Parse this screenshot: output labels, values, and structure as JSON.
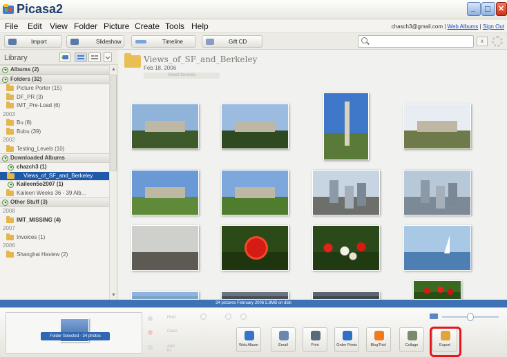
{
  "window": {
    "title": "Picasa2",
    "min_label": "_",
    "max_label": "□",
    "close_label": "✕"
  },
  "menu": [
    "File",
    "Edit",
    "View",
    "Folder",
    "Picture",
    "Create",
    "Tools",
    "Help"
  ],
  "account": {
    "email": "chasch3@gmail.com",
    "sep": "|",
    "web_albums": "Web Albums",
    "sign_out": "Sign Out"
  },
  "toolbar": {
    "import": "Import",
    "slideshow": "Slideshow",
    "timeline": "Timeline",
    "gift_cd": "Gift CD",
    "search_value": "",
    "clear_label": "x"
  },
  "library": {
    "title": "Library",
    "rows": [
      {
        "kind": "section",
        "label": "Albums (2)"
      },
      {
        "kind": "section",
        "label": "Folders (32)"
      },
      {
        "kind": "folder",
        "label": "Picture Porter (15)"
      },
      {
        "kind": "folder",
        "label": "DF_PR (3)"
      },
      {
        "kind": "folder",
        "label": "IMT_Pre-Load (6)"
      },
      {
        "kind": "year",
        "label": "2003"
      },
      {
        "kind": "folder",
        "label": "Bu (8)"
      },
      {
        "kind": "folder",
        "label": "Bubu (39)"
      },
      {
        "kind": "year",
        "label": "2002"
      },
      {
        "kind": "folder",
        "label": "Testing_Levels (10)"
      },
      {
        "kind": "section",
        "label": "Downloaded Albums"
      },
      {
        "kind": "sub",
        "label": "chazch3 (1)"
      },
      {
        "kind": "selected",
        "label": "Views_of_SF_and_Berkeley"
      },
      {
        "kind": "sub",
        "label": "Kaileen5o2007 (1)"
      },
      {
        "kind": "folder",
        "label": "Kaileen Weeks 36 - 39 Alb..."
      },
      {
        "kind": "section",
        "label": "Other Stuff (3)"
      },
      {
        "kind": "year",
        "label": "2008"
      },
      {
        "kind": "folder-bold",
        "label": "IMT_MISSING (4)"
      },
      {
        "kind": "year",
        "label": "2007"
      },
      {
        "kind": "folder",
        "label": "Invoices (1)"
      },
      {
        "kind": "year",
        "label": "2006"
      },
      {
        "kind": "folder",
        "label": "Shanghai Haview (2)"
      }
    ]
  },
  "folder": {
    "title": "Views_of_SF_and_Berkeley",
    "date": "Feb 18, 2006",
    "action": "Select Sources"
  },
  "photos": [
    {
      "desc": "Berkeley Sather Gate",
      "sky": "#8fb3d9",
      "ground": "#3f5a2a"
    },
    {
      "desc": "Campanile through trees",
      "sky": "#9bbbe0",
      "ground": "#2f4a20"
    },
    {
      "desc": "Sather Tower",
      "sky": "#3f78c8",
      "ground": "#5a7a3a"
    },
    {
      "desc": "Doe Library",
      "sky": "#e7edf3",
      "ground": "#6f7a4a"
    },
    {
      "desc": "Doe Library facade",
      "sky": "#6a9ad6",
      "ground": "#5f8a3a"
    },
    {
      "desc": "Library with lawn",
      "sky": "#7ea8dc",
      "ground": "#4f7d2d"
    },
    {
      "desc": "City view",
      "sky": "#c7d4e2",
      "ground": "#6c6f6a"
    },
    {
      "desc": "SF skyline",
      "sky": "#b7c8d8",
      "ground": "#7b8a96"
    },
    {
      "desc": "Street view",
      "sky": "#cfcfcb",
      "ground": "#5c5a52"
    },
    {
      "desc": "Red tulip",
      "sky": "#2c4a18",
      "ground": "#1f3510"
    },
    {
      "desc": "Tulip field",
      "sky": "#2a4a1a",
      "ground": "#203a12"
    },
    {
      "desc": "Sailboat on the bay",
      "sky": "#a8c8e6",
      "ground": "#4d7fb3"
    },
    {
      "desc": "Partial sky",
      "sky": "#8eb5dd",
      "ground": "#7ea3c8"
    },
    {
      "desc": "Partial city",
      "sky": "#6a7380",
      "ground": "#4a4f55"
    },
    {
      "desc": "Partial street",
      "sky": "#5b6570",
      "ground": "#40464d"
    },
    {
      "desc": "Partial flowers",
      "sky": "#3a6a22",
      "ground": "#2a4f16"
    }
  ],
  "status_text": "34 pictures   February 2006   5.8MB on disk",
  "tray": {
    "selection_label": "Folder Selected - 34 photos",
    "hold": "Hold",
    "clear": "Clear",
    "add_to": "Add to",
    "actions": [
      {
        "label": "Web Album",
        "color": "#3a74c8"
      },
      {
        "label": "Email",
        "color": "#6a87b0"
      },
      {
        "label": "Print",
        "color": "#5a6a7a"
      },
      {
        "label": "Order Prints",
        "color": "#2f6fc4"
      },
      {
        "label": "BlogThis!",
        "color": "#f07a1c"
      },
      {
        "label": "Collage",
        "color": "#7a8a6a"
      },
      {
        "label": "Export",
        "color": "#e1a33a"
      }
    ]
  },
  "accent_colors": {
    "status_bar": "#3e72b4",
    "selection": "#1f5aa8",
    "export_highlight": "#e8141a"
  }
}
